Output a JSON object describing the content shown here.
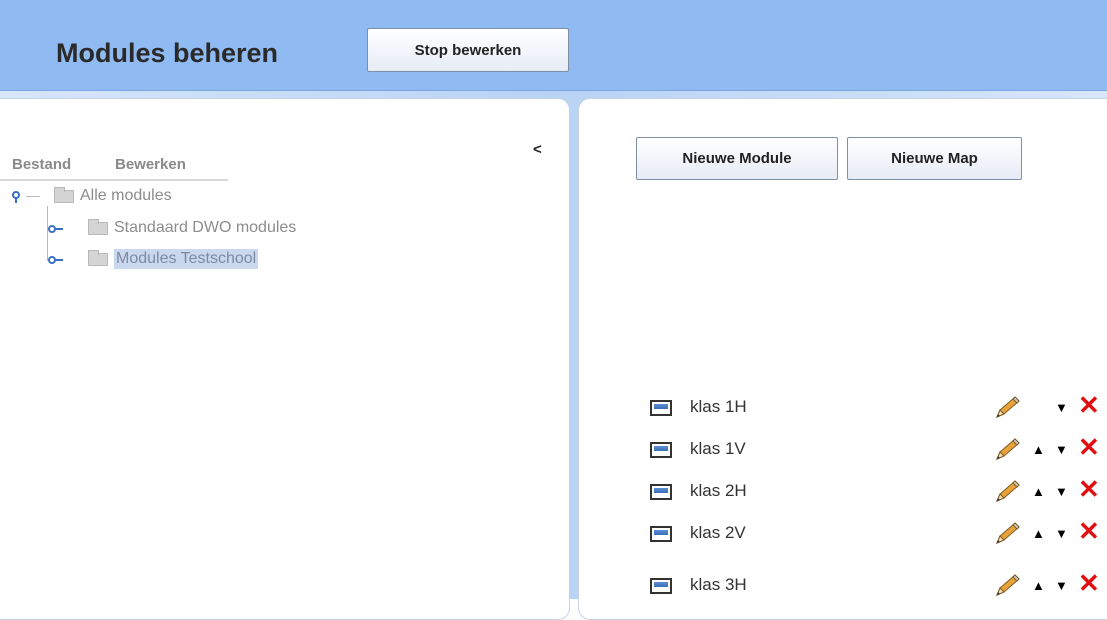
{
  "header": {
    "title": "Modules beheren",
    "stop_button": "Stop bewerken"
  },
  "left_panel": {
    "collapse": "<",
    "menu": [
      "Bestand",
      "Bewerken"
    ],
    "tree": {
      "root": "Alle modules",
      "children": [
        "Standaard DWO modules",
        "Modules Testschool"
      ],
      "selected": "Modules Testschool"
    }
  },
  "right_panel": {
    "buttons": {
      "new_module": "Nieuwe Module",
      "new_folder": "Nieuwe Map"
    },
    "modules": [
      {
        "label": "klas 1H",
        "up": false,
        "down": true
      },
      {
        "label": "klas 1V",
        "up": true,
        "down": true
      },
      {
        "label": "klas 2H",
        "up": true,
        "down": true
      },
      {
        "label": "klas 2V",
        "up": true,
        "down": true
      },
      {
        "label": "klas 3H",
        "up": true,
        "down": true
      }
    ],
    "icons": {
      "edit": "pencil-icon",
      "up": "arrow-up-icon",
      "down": "arrow-down-icon",
      "delete": "delete-x-icon"
    },
    "colors": {
      "delete": "#e01010",
      "header": "#8fbaf2"
    }
  }
}
